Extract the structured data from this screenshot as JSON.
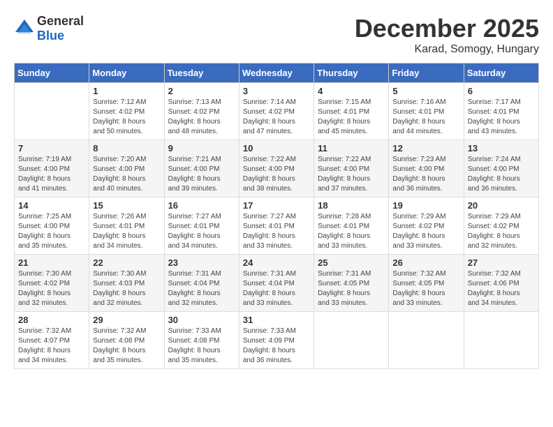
{
  "header": {
    "logo_general": "General",
    "logo_blue": "Blue",
    "month": "December 2025",
    "location": "Karad, Somogy, Hungary"
  },
  "weekdays": [
    "Sunday",
    "Monday",
    "Tuesday",
    "Wednesday",
    "Thursday",
    "Friday",
    "Saturday"
  ],
  "weeks": [
    [
      {
        "day": "",
        "info": ""
      },
      {
        "day": "1",
        "info": "Sunrise: 7:12 AM\nSunset: 4:02 PM\nDaylight: 8 hours\nand 50 minutes."
      },
      {
        "day": "2",
        "info": "Sunrise: 7:13 AM\nSunset: 4:02 PM\nDaylight: 8 hours\nand 48 minutes."
      },
      {
        "day": "3",
        "info": "Sunrise: 7:14 AM\nSunset: 4:02 PM\nDaylight: 8 hours\nand 47 minutes."
      },
      {
        "day": "4",
        "info": "Sunrise: 7:15 AM\nSunset: 4:01 PM\nDaylight: 8 hours\nand 45 minutes."
      },
      {
        "day": "5",
        "info": "Sunrise: 7:16 AM\nSunset: 4:01 PM\nDaylight: 8 hours\nand 44 minutes."
      },
      {
        "day": "6",
        "info": "Sunrise: 7:17 AM\nSunset: 4:01 PM\nDaylight: 8 hours\nand 43 minutes."
      }
    ],
    [
      {
        "day": "7",
        "info": "Sunrise: 7:19 AM\nSunset: 4:00 PM\nDaylight: 8 hours\nand 41 minutes."
      },
      {
        "day": "8",
        "info": "Sunrise: 7:20 AM\nSunset: 4:00 PM\nDaylight: 8 hours\nand 40 minutes."
      },
      {
        "day": "9",
        "info": "Sunrise: 7:21 AM\nSunset: 4:00 PM\nDaylight: 8 hours\nand 39 minutes."
      },
      {
        "day": "10",
        "info": "Sunrise: 7:22 AM\nSunset: 4:00 PM\nDaylight: 8 hours\nand 38 minutes."
      },
      {
        "day": "11",
        "info": "Sunrise: 7:22 AM\nSunset: 4:00 PM\nDaylight: 8 hours\nand 37 minutes."
      },
      {
        "day": "12",
        "info": "Sunrise: 7:23 AM\nSunset: 4:00 PM\nDaylight: 8 hours\nand 36 minutes."
      },
      {
        "day": "13",
        "info": "Sunrise: 7:24 AM\nSunset: 4:00 PM\nDaylight: 8 hours\nand 36 minutes."
      }
    ],
    [
      {
        "day": "14",
        "info": "Sunrise: 7:25 AM\nSunset: 4:00 PM\nDaylight: 8 hours\nand 35 minutes."
      },
      {
        "day": "15",
        "info": "Sunrise: 7:26 AM\nSunset: 4:01 PM\nDaylight: 8 hours\nand 34 minutes."
      },
      {
        "day": "16",
        "info": "Sunrise: 7:27 AM\nSunset: 4:01 PM\nDaylight: 8 hours\nand 34 minutes."
      },
      {
        "day": "17",
        "info": "Sunrise: 7:27 AM\nSunset: 4:01 PM\nDaylight: 8 hours\nand 33 minutes."
      },
      {
        "day": "18",
        "info": "Sunrise: 7:28 AM\nSunset: 4:01 PM\nDaylight: 8 hours\nand 33 minutes."
      },
      {
        "day": "19",
        "info": "Sunrise: 7:29 AM\nSunset: 4:02 PM\nDaylight: 8 hours\nand 33 minutes."
      },
      {
        "day": "20",
        "info": "Sunrise: 7:29 AM\nSunset: 4:02 PM\nDaylight: 8 hours\nand 32 minutes."
      }
    ],
    [
      {
        "day": "21",
        "info": "Sunrise: 7:30 AM\nSunset: 4:02 PM\nDaylight: 8 hours\nand 32 minutes."
      },
      {
        "day": "22",
        "info": "Sunrise: 7:30 AM\nSunset: 4:03 PM\nDaylight: 8 hours\nand 32 minutes."
      },
      {
        "day": "23",
        "info": "Sunrise: 7:31 AM\nSunset: 4:04 PM\nDaylight: 8 hours\nand 32 minutes."
      },
      {
        "day": "24",
        "info": "Sunrise: 7:31 AM\nSunset: 4:04 PM\nDaylight: 8 hours\nand 33 minutes."
      },
      {
        "day": "25",
        "info": "Sunrise: 7:31 AM\nSunset: 4:05 PM\nDaylight: 8 hours\nand 33 minutes."
      },
      {
        "day": "26",
        "info": "Sunrise: 7:32 AM\nSunset: 4:05 PM\nDaylight: 8 hours\nand 33 minutes."
      },
      {
        "day": "27",
        "info": "Sunrise: 7:32 AM\nSunset: 4:06 PM\nDaylight: 8 hours\nand 34 minutes."
      }
    ],
    [
      {
        "day": "28",
        "info": "Sunrise: 7:32 AM\nSunset: 4:07 PM\nDaylight: 8 hours\nand 34 minutes."
      },
      {
        "day": "29",
        "info": "Sunrise: 7:32 AM\nSunset: 4:08 PM\nDaylight: 8 hours\nand 35 minutes."
      },
      {
        "day": "30",
        "info": "Sunrise: 7:33 AM\nSunset: 4:08 PM\nDaylight: 8 hours\nand 35 minutes."
      },
      {
        "day": "31",
        "info": "Sunrise: 7:33 AM\nSunset: 4:09 PM\nDaylight: 8 hours\nand 36 minutes."
      },
      {
        "day": "",
        "info": ""
      },
      {
        "day": "",
        "info": ""
      },
      {
        "day": "",
        "info": ""
      }
    ]
  ]
}
